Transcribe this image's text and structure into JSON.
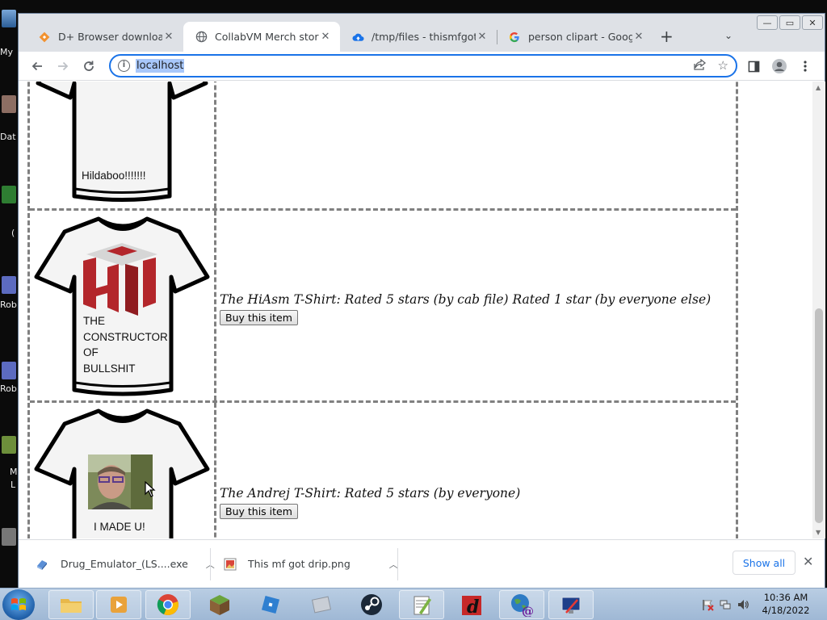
{
  "desktop": {
    "labels": [
      "My",
      "Dat",
      "(",
      "Rob",
      "Rob",
      "M",
      "L"
    ]
  },
  "window_controls": {
    "minimize": "—",
    "maximize": "▭",
    "close": "✕"
  },
  "tabs": [
    {
      "title": "D+ Browser download |",
      "active": false
    },
    {
      "title": "CollabVM Merch store",
      "active": true
    },
    {
      "title": "/tmp/files - thismfgotdr",
      "active": false
    },
    {
      "title": "person clipart - Google",
      "active": false
    }
  ],
  "toolbar": {
    "url": "localhost",
    "new_tab": "+",
    "tab_menu": "⌄"
  },
  "products": [
    {
      "shirt_text": "Hildaboo!!!!!!!",
      "title": "",
      "buy_label": ""
    },
    {
      "shirt_text": [
        "THE",
        "CONSTRUCTOR",
        "OF",
        "BULLSHIT"
      ],
      "title": "The HiAsm T-Shirt: Rated 5 stars (by cab file) Rated 1 star (by everyone else)",
      "buy_label": "Buy this item"
    },
    {
      "shirt_text": "I MADE U!",
      "title": "The Andrej T-Shirt: Rated 5 stars (by everyone)",
      "buy_label": "Buy this item"
    }
  ],
  "downloads": [
    {
      "name": "Drug_Emulator_(LS....exe"
    },
    {
      "name": "This mf got drip.png"
    }
  ],
  "downloads_bar": {
    "show_all": "Show all",
    "close": "✕"
  },
  "clock": {
    "time": "10:36 AM",
    "date": "4/18/2022"
  },
  "colors": {
    "accent": "#1a73e8",
    "border_dashed": "#808080",
    "shirt_logo_red": "#b3262b"
  }
}
